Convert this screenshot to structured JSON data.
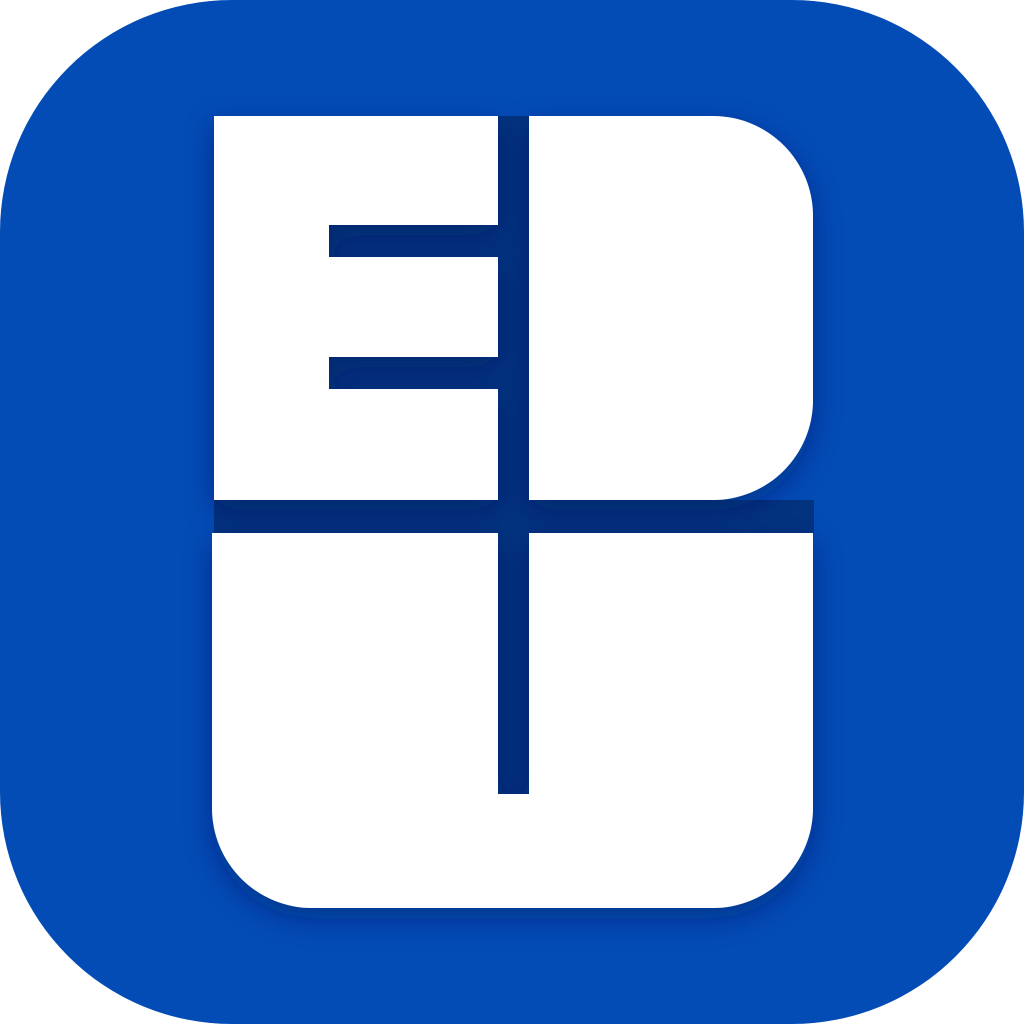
{
  "icon": {
    "logo_text": "EDU",
    "background_color": "#034BB5",
    "mark_color": "#FFFFFF",
    "shadow_color": "#02337F"
  }
}
